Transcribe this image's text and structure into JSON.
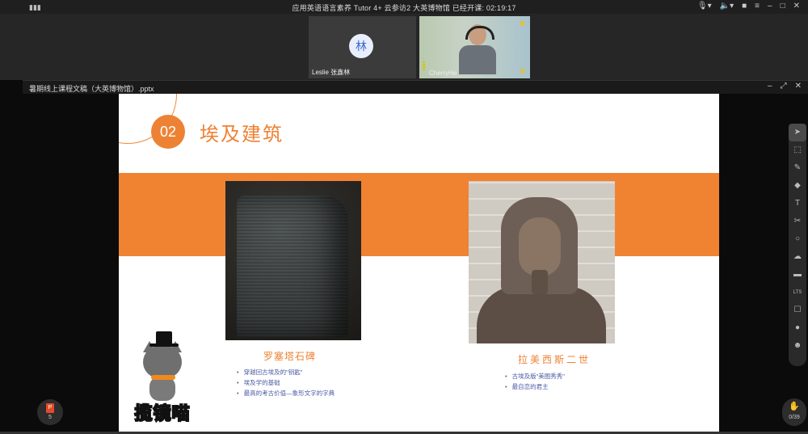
{
  "meeting": {
    "title": "应用英语语言素养 Tutor 4+ 云参访2 大英博物馆   已经开课: 02:19:17"
  },
  "participants": [
    {
      "name": "Leslie 张鑫林",
      "avatar": "林"
    },
    {
      "name": "CherryHe"
    }
  ],
  "document": {
    "filename": "暑期线上课程文稿（大英博物馆）.pptx"
  },
  "slide": {
    "number": "02",
    "title": "埃及建筑",
    "left_caption": "罗塞塔石碑",
    "left_bullets": [
      "穿越回古埃及的\"钥匙\"",
      "埃及学的基础",
      "最高的考古价值—象形文字的字典"
    ],
    "right_caption": "拉美西斯二世",
    "right_bullets": [
      "古埃及版\"美图秀秀\"",
      "最自恋的君主"
    ],
    "mascot_text": "揽镜喵",
    "accent_color": "#EE8234"
  },
  "toolbar": {
    "tools": [
      "pointer-icon",
      "select-icon",
      "pen-icon",
      "eraser-icon",
      "text-icon",
      "scissors-icon",
      "shape-icon",
      "cloud-icon",
      "toolbox-icon",
      "laser-icon",
      "edit-icon",
      "chat-icon",
      "people-icon"
    ],
    "tool_text": "LTS"
  },
  "page_indicator": {
    "label": "P",
    "page": "5"
  },
  "counter": {
    "value": "0/39"
  }
}
